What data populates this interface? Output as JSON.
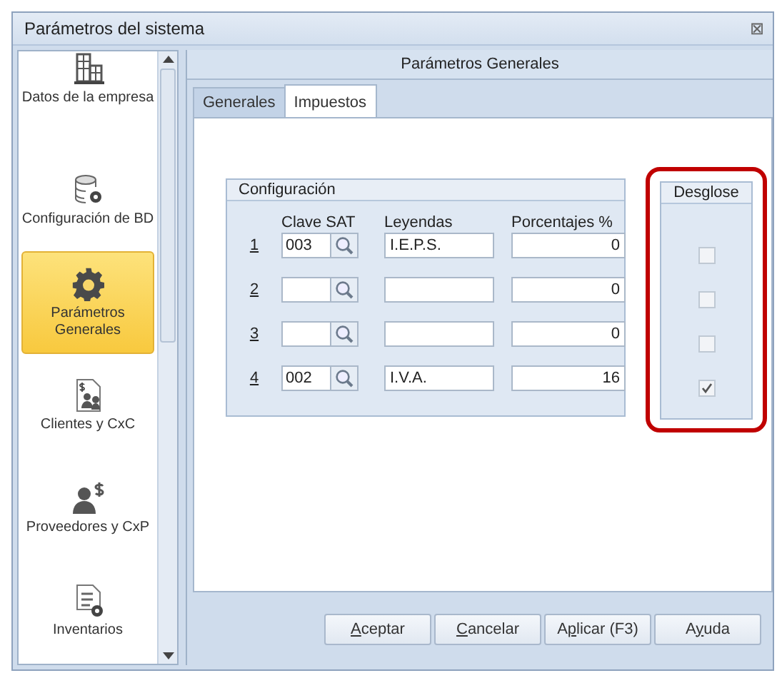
{
  "window": {
    "title": "Parámetros del sistema",
    "close": "⊠"
  },
  "sidebar": {
    "items": [
      {
        "label": "Datos de la empresa",
        "kind": "company",
        "selected": false
      },
      {
        "label": "Configuración de BD",
        "kind": "database",
        "selected": false
      },
      {
        "label": "Parámetros Generales",
        "kind": "parameters",
        "selected": true
      },
      {
        "label": "Clientes y CxC",
        "kind": "clients",
        "selected": false
      },
      {
        "label": "Proveedores y CxP",
        "kind": "suppliers",
        "selected": false
      },
      {
        "label": "Inventarios",
        "kind": "inventory",
        "selected": false
      }
    ]
  },
  "panel": {
    "title": "Parámetros Generales"
  },
  "tabs": [
    {
      "label": "Generales",
      "selected": false
    },
    {
      "label": "Impuestos",
      "selected": true
    }
  ],
  "configuracion": {
    "title": "Configuración",
    "columns": [
      "Clave SAT",
      "Leyendas",
      "Porcentajes %"
    ],
    "rows": [
      {
        "number": "1",
        "clave": "003",
        "leyenda": "I.E.P.S.",
        "porcentaje": "0"
      },
      {
        "number": "2",
        "clave": "",
        "leyenda": "",
        "porcentaje": "0"
      },
      {
        "number": "3",
        "clave": "",
        "leyenda": "",
        "porcentaje": "0"
      },
      {
        "number": "4",
        "clave": "002",
        "leyenda": "I.V.A.",
        "porcentaje": "16"
      }
    ]
  },
  "desglose": {
    "title": "Desglose",
    "highlighted": true,
    "checks": [
      {
        "checked": false
      },
      {
        "checked": false
      },
      {
        "checked": false
      },
      {
        "checked": true
      }
    ]
  },
  "buttons": [
    {
      "key": "A",
      "after": "ceptar"
    },
    {
      "key": "C",
      "after": "ancelar"
    },
    {
      "before": "A",
      "key": "p",
      "after": "licar (F3)"
    },
    {
      "before": "A",
      "key": "y",
      "after": "uda"
    }
  ]
}
